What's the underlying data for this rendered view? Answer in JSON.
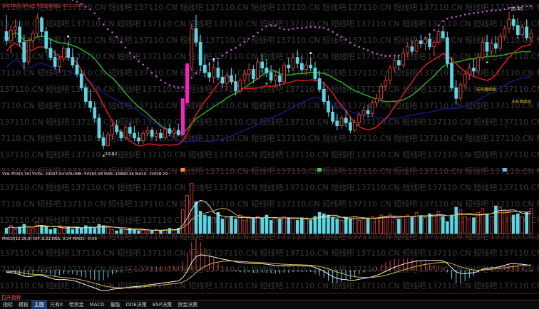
{
  "header": {
    "main_legend": "(自动显示指标)主力资金动向(1.00,11.00)",
    "main_legend_color": "#ff3b3b"
  },
  "annotations": {
    "high_label": "15.45",
    "low_label": "10.92",
    "note_1": "主升浪启动",
    "note_2": "主升浪启动"
  },
  "watermark": {
    "text": "137110.CN 短线吧",
    "color": "#3a3a3a"
  },
  "volume_panel": {
    "legend": "VOL-TDX(5,10) VVOL: 23047.94  VOLUME: 50265.28  MA5: 10890.36  MA10: 12026.29"
  },
  "macd_panel": {
    "legend": "MACD(12,26,9) DIF: 0.21  DEA: 0.24  MACD: -0.06"
  },
  "tabs": [
    "指标",
    "模板",
    "主图",
    "只有K",
    "带资金",
    "MACD",
    "量能",
    "DDE决策",
    "BSP决策",
    "资金决策"
  ],
  "active_tab": 2,
  "bottom_flag": "拉升指标",
  "colors": {
    "up": "#e8403a",
    "down": "#57d8e6",
    "ma_red": "#d21a1a",
    "ma_green": "#2aa31a",
    "ma_navy": "#17187a",
    "band_purple": "#b95cc9",
    "signal_magenta": "#ff1ec8",
    "dif": "#f0f0f0",
    "dea": "#d5b34a"
  },
  "chart_data": [
    {
      "type": "candlestick",
      "series_name": "price",
      "x": "session index 0-119",
      "ylim": [
        10.4,
        15.7
      ],
      "ohlc": [
        [
          14.8,
          15.35,
          14.35,
          14.5
        ],
        [
          14.5,
          15.0,
          14.1,
          14.85
        ],
        [
          14.85,
          15.2,
          14.6,
          14.95
        ],
        [
          14.95,
          15.15,
          14.3,
          14.45
        ],
        [
          14.45,
          14.7,
          13.55,
          13.8
        ],
        [
          13.8,
          14.6,
          13.7,
          14.5
        ],
        [
          14.5,
          14.85,
          14.25,
          14.75
        ],
        [
          14.75,
          15.4,
          14.6,
          15.25
        ],
        [
          15.25,
          15.3,
          14.65,
          14.8
        ],
        [
          14.8,
          14.95,
          14.1,
          14.25
        ],
        [
          14.25,
          14.55,
          13.85,
          13.95
        ],
        [
          13.95,
          14.2,
          13.55,
          13.65
        ],
        [
          13.65,
          14.0,
          13.45,
          13.9
        ],
        [
          13.9,
          14.35,
          13.8,
          14.25
        ],
        [
          14.25,
          14.5,
          13.85,
          13.95
        ],
        [
          13.95,
          14.25,
          13.6,
          13.7
        ],
        [
          13.7,
          13.95,
          13.3,
          13.4
        ],
        [
          13.4,
          13.55,
          12.85,
          12.95
        ],
        [
          12.95,
          13.1,
          12.4,
          12.5
        ],
        [
          12.5,
          12.9,
          12.15,
          12.3
        ],
        [
          12.3,
          12.5,
          11.8,
          11.95
        ],
        [
          11.95,
          12.1,
          11.2,
          11.3
        ],
        [
          11.3,
          11.5,
          10.92,
          11.05
        ],
        [
          11.05,
          11.5,
          11.0,
          11.4
        ],
        [
          11.4,
          11.8,
          11.25,
          11.7
        ],
        [
          11.7,
          11.9,
          11.4,
          11.5
        ],
        [
          11.5,
          11.6,
          11.2,
          11.3
        ],
        [
          11.3,
          11.75,
          11.25,
          11.65
        ],
        [
          11.65,
          11.8,
          11.35,
          11.45
        ],
        [
          11.45,
          11.7,
          11.2,
          11.3
        ],
        [
          11.3,
          11.5,
          11.1,
          11.2
        ],
        [
          11.2,
          11.55,
          11.1,
          11.45
        ],
        [
          11.45,
          11.7,
          11.35,
          11.55
        ],
        [
          11.55,
          11.65,
          11.25,
          11.35
        ],
        [
          11.35,
          11.55,
          11.2,
          11.45
        ],
        [
          11.45,
          11.6,
          11.25,
          11.3
        ],
        [
          11.3,
          11.7,
          11.25,
          11.6
        ],
        [
          11.6,
          11.75,
          11.35,
          11.45
        ],
        [
          11.45,
          11.65,
          11.3,
          11.55
        ],
        [
          11.55,
          11.75,
          11.35,
          11.4
        ],
        [
          11.4,
          12.55,
          11.35,
          12.45
        ],
        [
          12.45,
          13.7,
          12.35,
          13.6
        ],
        [
          13.6,
          15.05,
          13.5,
          14.9
        ],
        [
          14.9,
          15.35,
          14.3,
          14.45
        ],
        [
          14.45,
          14.7,
          13.55,
          13.7
        ],
        [
          13.7,
          14.05,
          13.3,
          13.45
        ],
        [
          13.45,
          13.8,
          13.15,
          13.3
        ],
        [
          13.3,
          13.75,
          13.1,
          13.6
        ],
        [
          13.6,
          13.85,
          13.2,
          13.3
        ],
        [
          13.3,
          13.55,
          12.95,
          13.1
        ],
        [
          13.1,
          13.45,
          12.85,
          13.35
        ],
        [
          13.35,
          13.6,
          13.05,
          13.15
        ],
        [
          13.15,
          13.4,
          12.7,
          12.85
        ],
        [
          12.85,
          13.3,
          12.75,
          13.2
        ],
        [
          13.2,
          13.55,
          13.05,
          13.4
        ],
        [
          13.4,
          13.75,
          13.15,
          13.55
        ],
        [
          13.55,
          13.7,
          13.1,
          13.25
        ],
        [
          13.25,
          13.95,
          13.2,
          13.8
        ],
        [
          13.8,
          14.05,
          13.45,
          13.6
        ],
        [
          13.6,
          13.9,
          13.3,
          13.45
        ],
        [
          13.45,
          13.7,
          13.1,
          13.2
        ],
        [
          13.2,
          13.5,
          12.95,
          13.35
        ],
        [
          13.35,
          13.6,
          13.0,
          13.15
        ],
        [
          13.15,
          13.8,
          13.05,
          13.7
        ],
        [
          13.7,
          13.95,
          13.45,
          13.6
        ],
        [
          13.6,
          14.1,
          13.5,
          13.95
        ],
        [
          13.95,
          14.2,
          13.6,
          13.75
        ],
        [
          13.75,
          14.0,
          13.4,
          13.55
        ],
        [
          13.55,
          13.85,
          13.35,
          13.7
        ],
        [
          13.7,
          13.95,
          13.5,
          13.6
        ],
        [
          13.6,
          13.8,
          13.15,
          13.25
        ],
        [
          13.25,
          13.5,
          12.8,
          12.9
        ],
        [
          12.9,
          13.15,
          12.4,
          12.5
        ],
        [
          12.5,
          12.7,
          12.0,
          12.15
        ],
        [
          12.15,
          12.35,
          11.75,
          11.85
        ],
        [
          11.85,
          12.1,
          11.55,
          11.7
        ],
        [
          11.7,
          12.05,
          11.6,
          11.95
        ],
        [
          11.95,
          12.2,
          11.65,
          11.8
        ],
        [
          11.8,
          12.0,
          11.45,
          11.55
        ],
        [
          11.55,
          11.9,
          11.5,
          11.8
        ],
        [
          11.8,
          12.15,
          11.7,
          12.05
        ],
        [
          12.05,
          12.35,
          11.9,
          12.2
        ],
        [
          12.2,
          12.4,
          11.95,
          12.1
        ],
        [
          12.1,
          12.55,
          12.0,
          12.45
        ],
        [
          12.45,
          12.75,
          12.3,
          12.6
        ],
        [
          12.6,
          13.1,
          12.5,
          13.0
        ],
        [
          13.0,
          13.35,
          12.85,
          13.2
        ],
        [
          13.2,
          13.7,
          13.05,
          13.6
        ],
        [
          13.6,
          14.0,
          13.45,
          13.85
        ],
        [
          13.85,
          14.05,
          13.55,
          13.7
        ],
        [
          13.7,
          14.25,
          13.6,
          14.1
        ],
        [
          14.1,
          14.45,
          13.95,
          14.3
        ],
        [
          14.3,
          14.5,
          14.05,
          14.15
        ],
        [
          14.15,
          14.6,
          14.1,
          14.5
        ],
        [
          14.5,
          14.7,
          14.25,
          14.4
        ],
        [
          14.4,
          14.65,
          14.2,
          14.55
        ],
        [
          14.55,
          14.75,
          14.2,
          14.3
        ],
        [
          14.3,
          14.55,
          14.0,
          14.45
        ],
        [
          14.45,
          14.9,
          14.35,
          14.8
        ],
        [
          14.8,
          15.0,
          14.5,
          14.6
        ],
        [
          14.6,
          14.8,
          13.6,
          13.75
        ],
        [
          13.75,
          13.95,
          12.85,
          12.95
        ],
        [
          12.95,
          13.2,
          12.4,
          12.6
        ],
        [
          12.6,
          13.15,
          12.5,
          13.05
        ],
        [
          13.05,
          13.5,
          12.9,
          13.4
        ],
        [
          13.4,
          13.75,
          13.2,
          13.6
        ],
        [
          13.6,
          13.9,
          13.35,
          13.5
        ],
        [
          13.5,
          14.1,
          13.4,
          13.95
        ],
        [
          13.95,
          14.6,
          13.85,
          14.45
        ],
        [
          14.45,
          14.7,
          14.0,
          14.15
        ],
        [
          14.15,
          14.55,
          14.05,
          14.4
        ],
        [
          14.4,
          14.65,
          14.1,
          14.25
        ],
        [
          14.25,
          14.75,
          14.15,
          14.65
        ],
        [
          14.65,
          15.0,
          14.5,
          14.9
        ],
        [
          14.9,
          15.45,
          14.75,
          15.2
        ],
        [
          15.2,
          15.35,
          14.85,
          15.0
        ],
        [
          15.0,
          15.25,
          14.55,
          14.7
        ],
        [
          14.7,
          15.05,
          14.6,
          14.95
        ],
        [
          14.95,
          15.2,
          14.5,
          14.6
        ],
        [
          14.6,
          14.9,
          14.4,
          14.75
        ]
      ]
    },
    {
      "type": "bar",
      "series_name": "volume",
      "values": [
        4,
        6,
        3,
        5,
        7,
        5,
        4,
        9,
        6,
        5,
        3,
        4,
        6,
        4,
        5,
        3,
        5,
        4,
        6,
        5,
        4,
        7,
        6,
        5,
        3,
        2,
        3,
        2,
        4,
        3,
        2,
        3,
        2,
        2,
        3,
        2,
        3,
        4,
        3,
        4,
        18,
        29,
        38,
        24,
        17,
        14,
        13,
        12,
        16,
        11,
        12,
        13,
        11,
        14,
        10,
        12,
        11,
        13,
        12,
        14,
        10,
        12,
        11,
        13,
        12,
        11,
        10,
        12,
        11,
        10,
        13,
        16,
        15,
        14,
        12,
        11,
        10,
        12,
        11,
        13,
        10,
        12,
        11,
        13,
        12,
        14,
        13,
        15,
        12,
        11,
        13,
        14,
        12,
        16,
        13,
        12,
        15,
        14,
        17,
        13,
        9,
        14,
        20,
        18,
        13,
        11,
        12,
        16,
        19,
        15,
        13,
        21,
        20,
        18,
        17,
        14,
        15,
        13,
        16,
        19
      ]
    },
    {
      "type": "line",
      "series_name": "MACD",
      "ylim": [
        -1.0,
        1.35
      ],
      "dif": [
        -0.1,
        -0.12,
        -0.15,
        -0.2,
        -0.28,
        -0.3,
        -0.28,
        -0.22,
        -0.25,
        -0.3,
        -0.36,
        -0.42,
        -0.44,
        -0.43,
        -0.45,
        -0.48,
        -0.52,
        -0.6,
        -0.68,
        -0.75,
        -0.82,
        -0.9,
        -0.95,
        -0.93,
        -0.88,
        -0.85,
        -0.84,
        -0.8,
        -0.78,
        -0.76,
        -0.75,
        -0.72,
        -0.68,
        -0.66,
        -0.63,
        -0.61,
        -0.57,
        -0.55,
        -0.52,
        -0.5,
        -0.35,
        -0.05,
        0.35,
        0.62,
        0.7,
        0.68,
        0.64,
        0.6,
        0.55,
        0.5,
        0.47,
        0.43,
        0.38,
        0.35,
        0.33,
        0.32,
        0.3,
        0.3,
        0.29,
        0.27,
        0.24,
        0.22,
        0.2,
        0.21,
        0.2,
        0.22,
        0.22,
        0.2,
        0.19,
        0.18,
        0.12,
        0.04,
        -0.06,
        -0.18,
        -0.3,
        -0.38,
        -0.42,
        -0.44,
        -0.47,
        -0.46,
        -0.42,
        -0.38,
        -0.35,
        -0.3,
        -0.24,
        -0.15,
        -0.06,
        0.04,
        0.13,
        0.2,
        0.27,
        0.33,
        0.37,
        0.41,
        0.43,
        0.45,
        0.44,
        0.44,
        0.45,
        0.43,
        0.3,
        0.1,
        -0.08,
        -0.15,
        -0.16,
        -0.14,
        -0.12,
        -0.06,
        0.04,
        0.08,
        0.11,
        0.12,
        0.16,
        0.21,
        0.28,
        0.3,
        0.28,
        0.27,
        0.24,
        0.21
      ],
      "dea": [
        -0.05,
        -0.06,
        -0.08,
        -0.1,
        -0.14,
        -0.17,
        -0.19,
        -0.2,
        -0.21,
        -0.23,
        -0.26,
        -0.29,
        -0.32,
        -0.34,
        -0.36,
        -0.39,
        -0.41,
        -0.45,
        -0.5,
        -0.55,
        -0.6,
        -0.66,
        -0.72,
        -0.76,
        -0.78,
        -0.8,
        -0.81,
        -0.81,
        -0.8,
        -0.79,
        -0.78,
        -0.77,
        -0.75,
        -0.73,
        -0.71,
        -0.69,
        -0.67,
        -0.64,
        -0.62,
        -0.6,
        -0.55,
        -0.45,
        -0.29,
        -0.11,
        0.05,
        0.17,
        0.26,
        0.33,
        0.37,
        0.4,
        0.41,
        0.42,
        0.41,
        0.4,
        0.39,
        0.37,
        0.36,
        0.35,
        0.34,
        0.33,
        0.31,
        0.3,
        0.28,
        0.27,
        0.26,
        0.25,
        0.25,
        0.24,
        0.23,
        0.22,
        0.2,
        0.17,
        0.12,
        0.06,
        -0.01,
        -0.09,
        -0.15,
        -0.21,
        -0.26,
        -0.3,
        -0.32,
        -0.33,
        -0.34,
        -0.33,
        -0.31,
        -0.28,
        -0.24,
        -0.18,
        -0.12,
        -0.06,
        0.0,
        0.06,
        0.12,
        0.17,
        0.22,
        0.26,
        0.29,
        0.32,
        0.34,
        0.36,
        0.35,
        0.3,
        0.22,
        0.15,
        0.09,
        0.04,
        0.01,
        -0.01,
        0.0,
        0.02,
        0.04,
        0.06,
        0.08,
        0.1,
        0.14,
        0.17,
        0.19,
        0.21,
        0.22,
        0.24
      ]
    }
  ]
}
